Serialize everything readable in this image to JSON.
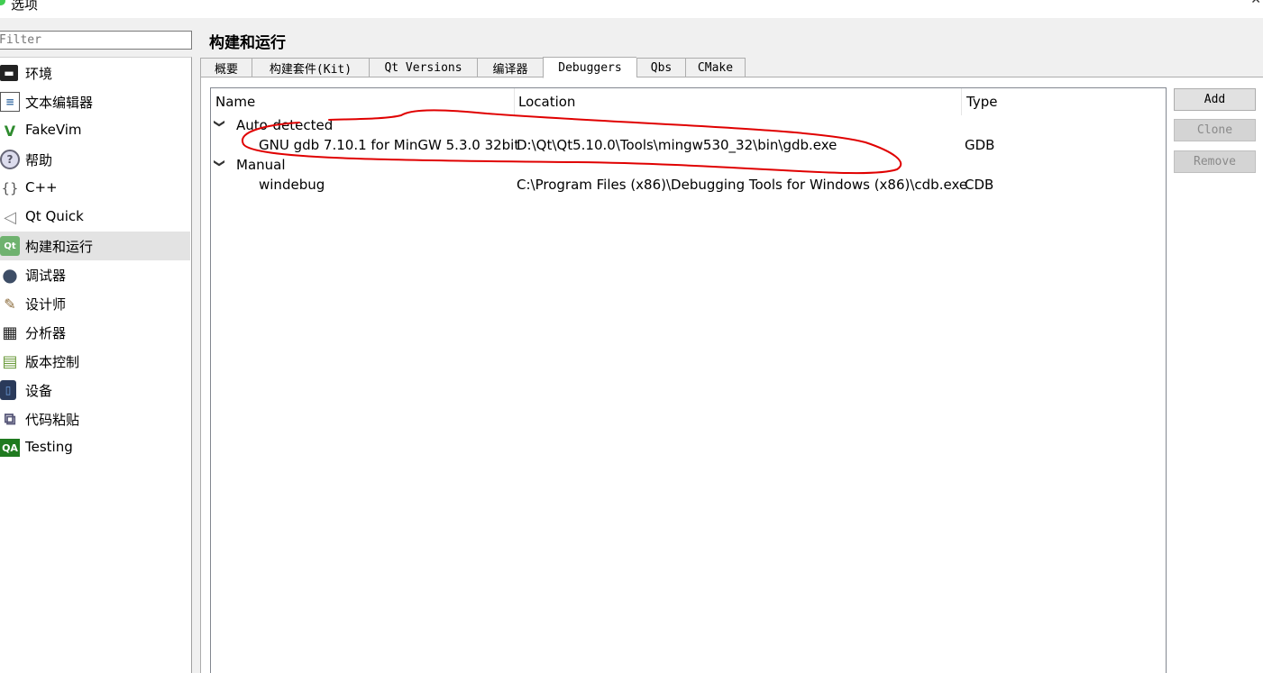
{
  "window": {
    "title": "选项",
    "close_glyph": "✕"
  },
  "filter": {
    "placeholder": "Filter"
  },
  "sidebar": {
    "items": [
      {
        "label": "环境",
        "icon": "monitor-icon",
        "glyph": "▬"
      },
      {
        "label": "文本编辑器",
        "icon": "text-editor-icon",
        "glyph": "≡"
      },
      {
        "label": "FakeVim",
        "icon": "fakevim-icon",
        "glyph": "V"
      },
      {
        "label": "帮助",
        "icon": "help-icon",
        "glyph": "?"
      },
      {
        "label": "C++",
        "icon": "cpp-braces-icon",
        "glyph": "{}"
      },
      {
        "label": "Qt Quick",
        "icon": "qt-quick-icon",
        "glyph": "◁"
      },
      {
        "label": "构建和运行",
        "icon": "build-run-icon",
        "glyph": "Qt"
      },
      {
        "label": "调试器",
        "icon": "debugger-icon",
        "glyph": "●"
      },
      {
        "label": "设计师",
        "icon": "designer-icon",
        "glyph": "✎"
      },
      {
        "label": "分析器",
        "icon": "analyzer-icon",
        "glyph": "▦"
      },
      {
        "label": "版本控制",
        "icon": "version-control-icon",
        "glyph": "▤"
      },
      {
        "label": "设备",
        "icon": "device-icon",
        "glyph": "▯"
      },
      {
        "label": "代码粘贴",
        "icon": "code-paster-icon",
        "glyph": "⧉"
      },
      {
        "label": "Testing",
        "icon": "testing-qa-icon",
        "glyph": "QA"
      }
    ],
    "selected_index": 6
  },
  "page": {
    "title": "构建和运行"
  },
  "tabs": [
    {
      "label": "概要"
    },
    {
      "label": "构建套件(Kit)"
    },
    {
      "label": "Qt Versions"
    },
    {
      "label": "编译器"
    },
    {
      "label": "Debuggers"
    },
    {
      "label": "Qbs"
    },
    {
      "label": "CMake"
    }
  ],
  "active_tab": "Debuggers",
  "tree": {
    "columns": {
      "name": "Name",
      "location": "Location",
      "type": "Type"
    },
    "groups": [
      {
        "label": "Auto-detected",
        "items": [
          {
            "name": "GNU gdb 7.10.1 for MinGW 5.3.0 32bit",
            "location": "D:\\Qt\\Qt5.10.0\\Tools\\mingw530_32\\bin\\gdb.exe",
            "type": "GDB"
          }
        ]
      },
      {
        "label": "Manual",
        "items": [
          {
            "name": "windebug",
            "location": "C:\\Program Files (x86)\\Debugging Tools for Windows (x86)\\cdb.exe",
            "type": "CDB"
          }
        ]
      }
    ],
    "expand_glyph": "❯"
  },
  "buttons": {
    "add": "Add",
    "clone": "Clone",
    "remove": "Remove"
  },
  "annotation_color": "#e00000"
}
